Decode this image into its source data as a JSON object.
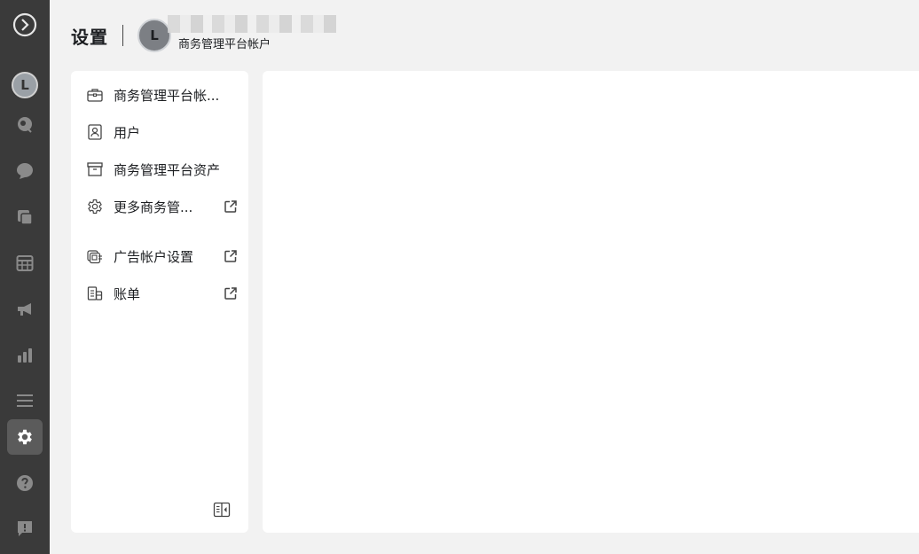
{
  "app": {
    "rail_avatar_letter": "L"
  },
  "header": {
    "title": "设置",
    "avatar_letter": "L",
    "account_subtitle": "商务管理平台帐户"
  },
  "settings_nav": [
    {
      "label": "商务管理平台帐...",
      "icon": "briefcase-icon",
      "external": false
    },
    {
      "label": "用户",
      "icon": "user-badge-icon",
      "external": false
    },
    {
      "label": "商务管理平台资产",
      "icon": "archive-box-icon",
      "external": false
    },
    {
      "label": "更多商务管...",
      "icon": "gear-outline-icon",
      "external": true
    },
    {
      "label": "广告帐户设置",
      "icon": "ad-account-icon",
      "external": true
    },
    {
      "label": "账单",
      "icon": "billing-stack-icon",
      "external": true
    }
  ],
  "colors": {
    "rail_bg": "#3a3a3a",
    "rail_active": "#5b5b5b",
    "page_bg": "#f2f2f2",
    "card_bg": "#ffffff"
  }
}
